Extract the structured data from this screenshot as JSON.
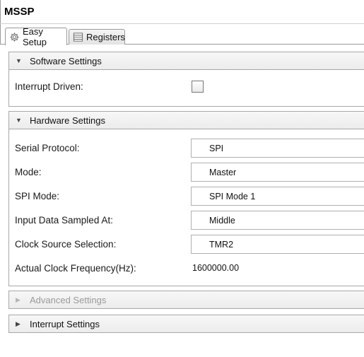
{
  "app": {
    "title": "MSSP"
  },
  "tabs": [
    {
      "label": "Easy Setup",
      "icon": "gear-icon",
      "active": true
    },
    {
      "label": "Registers",
      "icon": "table-icon",
      "active": false
    }
  ],
  "software_settings": {
    "title": "Software Settings",
    "interrupt_driven_label": "Interrupt Driven:",
    "interrupt_driven_checked": false
  },
  "hardware_settings": {
    "title": "Hardware Settings",
    "serial_protocol_label": "Serial Protocol:",
    "serial_protocol_value": "SPI",
    "mode_label": "Mode:",
    "mode_value": "Master",
    "spi_mode_label": "SPI Mode:",
    "spi_mode_value": "SPI Mode 1",
    "input_sampled_label": "Input Data Sampled At:",
    "input_sampled_value": "Middle",
    "clock_source_label": "Clock Source Selection:",
    "clock_source_value": "TMR2",
    "clock_freq_label": "Actual Clock Frequency(Hz):",
    "clock_freq_value": "1600000.00"
  },
  "advanced_settings": {
    "title": "Advanced Settings",
    "enabled": false
  },
  "interrupt_settings": {
    "title": "Interrupt Settings"
  }
}
